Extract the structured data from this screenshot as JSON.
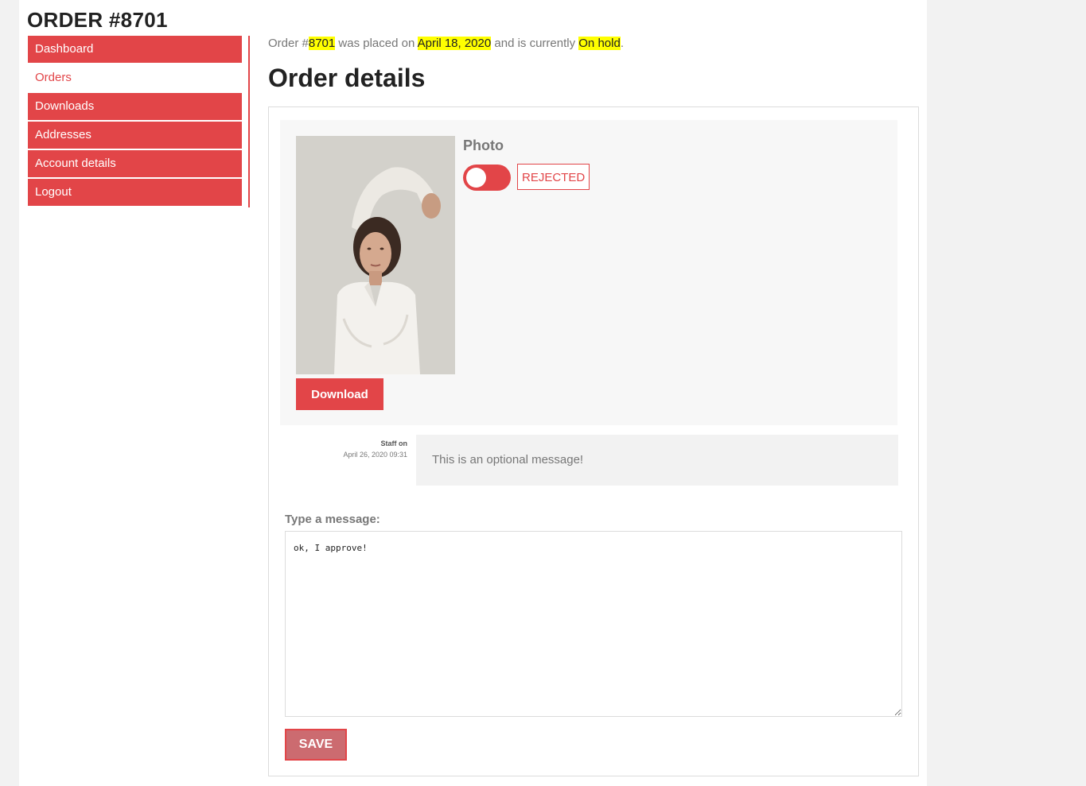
{
  "page": {
    "order_title": "ORDER #8701"
  },
  "nav": {
    "items": [
      {
        "label": "Dashboard"
      },
      {
        "label": "Orders"
      },
      {
        "label": "Downloads"
      },
      {
        "label": "Addresses"
      },
      {
        "label": "Account details"
      },
      {
        "label": "Logout"
      }
    ],
    "active": "Orders"
  },
  "summary": {
    "prefix": "Order #",
    "order_number": "8701",
    "placed_on_text": " was placed on ",
    "date": "April 18, 2020",
    "status_text": " and is currently ",
    "status": "On hold",
    "suffix": "."
  },
  "details": {
    "title": "Order details",
    "photo_label": "Photo",
    "status_badge": "REJECTED",
    "download_label": "Download"
  },
  "message": {
    "author": "Staff on",
    "timestamp": "April 26, 2020 09:31",
    "text": "This is an optional message!"
  },
  "form": {
    "label": "Type a message:",
    "value": "ok, I approve!",
    "save_label": "SAVE"
  },
  "colors": {
    "accent": "#e24548",
    "highlight": "#ffff00",
    "save_button": "#cc6b70"
  },
  "icons": {
    "toggle": "toggle-switch-icon"
  }
}
